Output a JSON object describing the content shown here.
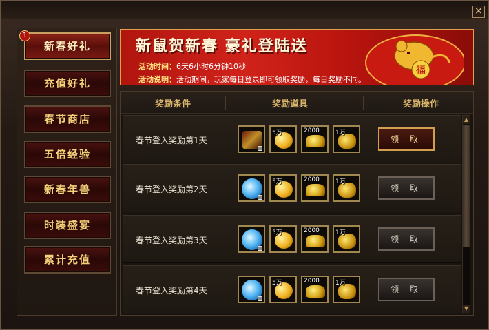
{
  "window": {
    "close_label": "×"
  },
  "sidebar": {
    "badge": "1",
    "items": [
      {
        "label": "新春好礼",
        "active": true
      },
      {
        "label": "充值好礼",
        "active": false
      },
      {
        "label": "春节商店",
        "active": false
      },
      {
        "label": "五倍经验",
        "active": false
      },
      {
        "label": "新春年兽",
        "active": false
      },
      {
        "label": "时装盛宴",
        "active": false
      },
      {
        "label": "累计充值",
        "active": false
      }
    ]
  },
  "banner": {
    "title": "新鼠贺新春 豪礼登陆送",
    "time_label": "活动时间：",
    "time_value": "6天6小时6分钟10秒",
    "desc_label": "活动说明：",
    "desc_value": "活动期间，玩家每日登录即可领取奖励，每日奖励不同。",
    "emblem_char": "福"
  },
  "table": {
    "headers": {
      "condition": "奖励条件",
      "items": "奖励道具",
      "action": "奖励操作"
    },
    "rows": [
      {
        "label": "春节登入奖励第1天",
        "first_icon": "red-treasure-icon",
        "qty": [
          "",
          "5万",
          "2000",
          "1万"
        ],
        "button": "领 取",
        "claimable": true
      },
      {
        "label": "春节登入奖励第2天",
        "first_icon": "blue-orb-icon",
        "qty": [
          "",
          "5万",
          "2000",
          "1万"
        ],
        "button": "领 取",
        "claimable": false
      },
      {
        "label": "春节登入奖励第3天",
        "first_icon": "blue-orb-icon",
        "qty": [
          "",
          "5万",
          "2000",
          "1万"
        ],
        "button": "领 取",
        "claimable": false
      },
      {
        "label": "春节登入奖励第4天",
        "first_icon": "blue-orb-icon",
        "qty": [
          "",
          "5万",
          "2000",
          "1万"
        ],
        "button": "领 取",
        "claimable": false
      }
    ]
  },
  "scroll": {
    "up": "▲",
    "down": "▼"
  }
}
